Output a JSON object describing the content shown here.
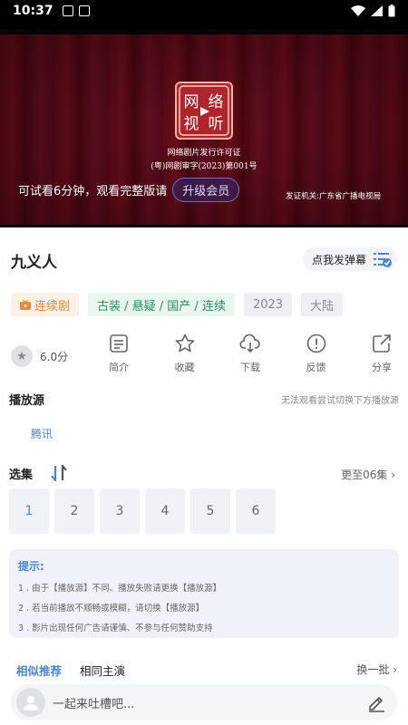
{
  "status_bar": {
    "time": "10:37"
  },
  "player": {
    "license_line1": "网络剧片发行许可证",
    "license_line2": "(粤)网剧审字(2023)第001号",
    "trial_text": "可试看6分钟，观看完整版请",
    "upgrade_label": "升级会员",
    "issuer": "发证机关:广东省广播电视局",
    "seal_chars": [
      "网",
      "络",
      "视",
      "听"
    ],
    "accent": "#b0252b"
  },
  "detail": {
    "title": "九义人",
    "danmu_label": "点我发弹幕",
    "tags": [
      {
        "label": "连续剧",
        "icon": "tv-icon"
      },
      {
        "label": "古装 / 悬疑 / 国产 / 连续"
      },
      {
        "label": "2023"
      },
      {
        "label": "大陆"
      }
    ],
    "rating": "6.0分",
    "actions": [
      {
        "label": "简介",
        "icon": "document-icon"
      },
      {
        "label": "收藏",
        "icon": "star-icon"
      },
      {
        "label": "下载",
        "icon": "download-icon"
      },
      {
        "label": "反馈",
        "icon": "alert-icon"
      },
      {
        "label": "分享",
        "icon": "share-icon"
      }
    ]
  },
  "sources": {
    "label": "播放源",
    "hint": "无法观看尝试切换下方播放源",
    "items": [
      "腾讯"
    ]
  },
  "episodes": {
    "label": "选集",
    "more": "更至06集",
    "items": [
      "1",
      "2",
      "3",
      "4",
      "5",
      "6"
    ],
    "active_index": 0
  },
  "tips": {
    "title": "提示:",
    "lines": [
      "1 . 由于【播放源】不同、播放失败请更换【播放源】",
      "2 . 若当前播放不顺畅或模糊，请切换【播放源】",
      "3 . 影片出现任何广告请谨慎、不参与任何赞助支持"
    ]
  },
  "recommend": {
    "tabs": [
      "相似推荐",
      "相同主演"
    ],
    "shuffle": "换一批"
  },
  "comment": {
    "placeholder": "一起来吐槽吧..."
  },
  "colors": {
    "link_blue": "#4a86d8",
    "video_red": "#5e0b15"
  }
}
